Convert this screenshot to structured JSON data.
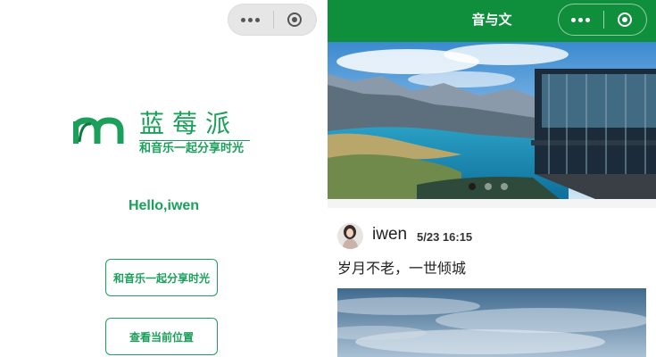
{
  "left_page": {
    "logo": {
      "title": "蓝莓派",
      "subtitle": "和音乐一起分享时光",
      "brand_color": "#1aa05a"
    },
    "greeting": "Hello,iwen",
    "buttons": [
      {
        "label": "和音乐一起分享时光"
      },
      {
        "label": "查看当前位置"
      }
    ],
    "capsule": {
      "more_icon": "more-dots-icon",
      "close_icon": "target-close-icon"
    }
  },
  "right_page": {
    "navbar": {
      "title": "音与文",
      "color": "#0f8f3c"
    },
    "swiper": {
      "dot_count": 3,
      "active_index": 0
    },
    "post": {
      "user": "iwen",
      "time": "5/23 16:15",
      "text": "岁月不老，一世倾城"
    },
    "capsule": {
      "more_icon": "more-dots-icon",
      "close_icon": "target-close-icon"
    }
  }
}
